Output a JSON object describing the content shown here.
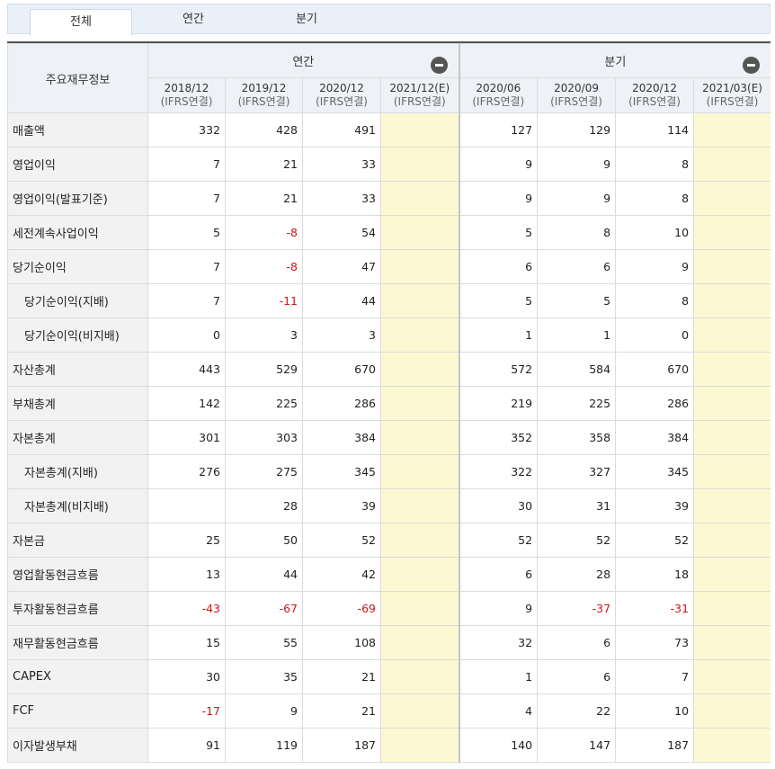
{
  "tabs": [
    {
      "label": "전체",
      "active": true
    },
    {
      "label": "연간",
      "active": false
    },
    {
      "label": "분기",
      "active": false
    }
  ],
  "table": {
    "corner_label": "주요재무정보",
    "groups": [
      {
        "label": "연간",
        "collapse_icon": "minus-circle-icon"
      },
      {
        "label": "분기",
        "collapse_icon": "minus-circle-icon"
      }
    ],
    "periods": [
      {
        "period": "2018/12",
        "basis": "(IFRS연결)",
        "estimate": false
      },
      {
        "period": "2019/12",
        "basis": "(IFRS연결)",
        "estimate": false
      },
      {
        "period": "2020/12",
        "basis": "(IFRS연결)",
        "estimate": false
      },
      {
        "period": "2021/12(E)",
        "basis": "(IFRS연결)",
        "estimate": true
      },
      {
        "period": "2020/06",
        "basis": "(IFRS연결)",
        "estimate": false
      },
      {
        "period": "2020/09",
        "basis": "(IFRS연결)",
        "estimate": false
      },
      {
        "period": "2020/12",
        "basis": "(IFRS연결)",
        "estimate": false
      },
      {
        "period": "2021/03(E)",
        "basis": "(IFRS연결)",
        "estimate": true
      }
    ],
    "rows": [
      {
        "label": "매출액",
        "indent": false,
        "values": [
          "332",
          "428",
          "491",
          "",
          "127",
          "129",
          "114",
          ""
        ]
      },
      {
        "label": "영업이익",
        "indent": false,
        "values": [
          "7",
          "21",
          "33",
          "",
          "9",
          "9",
          "8",
          ""
        ]
      },
      {
        "label": "영업이익(발표기준)",
        "indent": false,
        "values": [
          "7",
          "21",
          "33",
          "",
          "9",
          "9",
          "8",
          ""
        ]
      },
      {
        "label": "세전계속사업이익",
        "indent": false,
        "values": [
          "5",
          "-8",
          "54",
          "",
          "5",
          "8",
          "10",
          ""
        ]
      },
      {
        "label": "당기순이익",
        "indent": false,
        "values": [
          "7",
          "-8",
          "47",
          "",
          "6",
          "6",
          "9",
          ""
        ]
      },
      {
        "label": "당기순이익(지배)",
        "indent": true,
        "values": [
          "7",
          "-11",
          "44",
          "",
          "5",
          "5",
          "8",
          ""
        ]
      },
      {
        "label": "당기순이익(비지배)",
        "indent": true,
        "values": [
          "0",
          "3",
          "3",
          "",
          "1",
          "1",
          "0",
          ""
        ]
      },
      {
        "label": "자산총계",
        "indent": false,
        "values": [
          "443",
          "529",
          "670",
          "",
          "572",
          "584",
          "670",
          ""
        ]
      },
      {
        "label": "부채총계",
        "indent": false,
        "values": [
          "142",
          "225",
          "286",
          "",
          "219",
          "225",
          "286",
          ""
        ]
      },
      {
        "label": "자본총계",
        "indent": false,
        "values": [
          "301",
          "303",
          "384",
          "",
          "352",
          "358",
          "384",
          ""
        ]
      },
      {
        "label": "자본총계(지배)",
        "indent": true,
        "values": [
          "276",
          "275",
          "345",
          "",
          "322",
          "327",
          "345",
          ""
        ]
      },
      {
        "label": "자본총계(비지배)",
        "indent": true,
        "values": [
          "",
          "28",
          "39",
          "",
          "30",
          "31",
          "39",
          ""
        ]
      },
      {
        "label": "자본금",
        "indent": false,
        "values": [
          "25",
          "50",
          "52",
          "",
          "52",
          "52",
          "52",
          ""
        ]
      },
      {
        "label": "영업활동현금흐름",
        "indent": false,
        "values": [
          "13",
          "44",
          "42",
          "",
          "6",
          "28",
          "18",
          ""
        ]
      },
      {
        "label": "투자활동현금흐름",
        "indent": false,
        "values": [
          "-43",
          "-67",
          "-69",
          "",
          "9",
          "-37",
          "-31",
          ""
        ]
      },
      {
        "label": "재무활동현금흐름",
        "indent": false,
        "values": [
          "15",
          "55",
          "108",
          "",
          "32",
          "6",
          "73",
          ""
        ]
      },
      {
        "label": "CAPEX",
        "indent": false,
        "values": [
          "30",
          "35",
          "21",
          "",
          "1",
          "6",
          "7",
          ""
        ]
      },
      {
        "label": "FCF",
        "indent": false,
        "values": [
          "-17",
          "9",
          "21",
          "",
          "4",
          "22",
          "10",
          ""
        ]
      },
      {
        "label": "이자발생부채",
        "indent": false,
        "values": [
          "91",
          "119",
          "187",
          "",
          "140",
          "147",
          "187",
          ""
        ]
      }
    ]
  },
  "colors": {
    "negative": "#d2131a",
    "estimate_bg": "#fbf8d2",
    "header_bg": "#eef1f5",
    "label_bg": "#f2f2f2"
  }
}
